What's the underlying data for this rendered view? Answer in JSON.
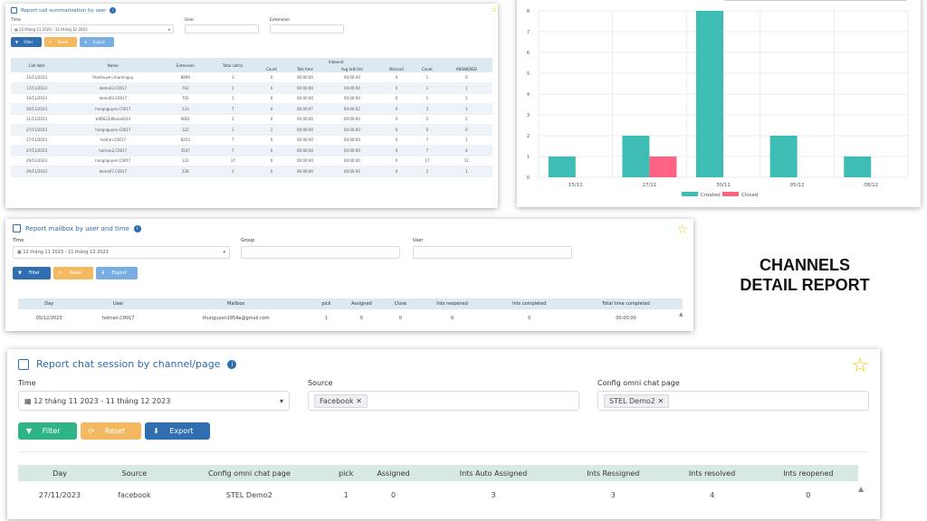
{
  "call_report": {
    "title": "Report call summarization by user",
    "filters": {
      "time_label": "Time",
      "time_value": "12 tháng 11 2023 - 11 tháng 12 2023",
      "user_label": "User",
      "extension_label": "Extension"
    },
    "buttons": {
      "filter": "Filter",
      "reset": "Reset",
      "export": "Export"
    },
    "group_header": "Inbound",
    "columns": [
      "Call date",
      "Name",
      "Extension",
      "Total call(s)",
      "Count",
      "Talk time",
      "Avg talk tim",
      "Misscall",
      "Count",
      "ANSWERED"
    ],
    "rows": [
      [
        "15/11/2023",
        "thanhuyen.chanhnguy",
        "8899",
        "1",
        "0",
        "00:00:00",
        "00:00:00",
        "0",
        "1",
        "0"
      ],
      [
        "17/11/2023",
        "demo03.C0017",
        "702",
        "1",
        "0",
        "00:00:00",
        "00:00:00",
        "0",
        "1",
        "1"
      ],
      [
        "19/11/2023",
        "demo03.C0017",
        "702",
        "1",
        "0",
        "00:00:00",
        "00:00:00",
        "0",
        "1",
        "1"
      ],
      [
        "20/11/2023",
        "hongnguyen.C0017",
        "133",
        "7",
        "4",
        "00:00:07",
        "00:00:02",
        "0",
        "3",
        "3"
      ],
      [
        "21/11/2023",
        "tdf6622d9a2e0034",
        "6001",
        "2",
        "0",
        "00:00:00",
        "00:00:00",
        "0",
        "2",
        "2"
      ],
      [
        "27/11/2023",
        "hongnguyen.C0017",
        "122",
        "1",
        "1",
        "00:00:00",
        "00:00:00",
        "0",
        "0",
        "0"
      ],
      [
        "27/11/2023",
        "hoitran.C0017",
        "8253",
        "7",
        "0",
        "00:00:00",
        "00:00:00",
        "0",
        "7",
        "1"
      ],
      [
        "27/11/2023",
        "hoitran2.C0017",
        "3547",
        "7",
        "0",
        "00:00:00",
        "00:00:00",
        "0",
        "7",
        "4"
      ],
      [
        "29/11/2023",
        "hongnguyen.C0017",
        "122",
        "17",
        "0",
        "00:00:00",
        "00:00:00",
        "0",
        "17",
        "12"
      ],
      [
        "29/11/2023",
        "demo07.C0017",
        "238",
        "2",
        "0",
        "00:00:00",
        "00:00:00",
        "0",
        "2",
        "1"
      ]
    ]
  },
  "chart_data": {
    "type": "bar",
    "categories": [
      "15/11",
      "27/11",
      "30/11",
      "05/12",
      "08/12"
    ],
    "series": [
      {
        "name": "Created",
        "color": "#3dbdb4",
        "values": [
          1,
          2,
          8,
          2,
          1
        ]
      },
      {
        "name": "Closed",
        "color": "#ff6384",
        "values": [
          0,
          1,
          0,
          0,
          0
        ]
      }
    ],
    "ylim": [
      0,
      8
    ],
    "yticks": [
      "0",
      "1",
      "2",
      "3",
      "4",
      "5",
      "6",
      "7",
      "8"
    ],
    "grid": true,
    "legend": "bottom"
  },
  "mailbox_report": {
    "title": "Report mailbox by user and time",
    "filters": {
      "time_label": "Time",
      "time_value": "12 tháng 11 2023 - 11 tháng 12 2023",
      "group_label": "Group",
      "user_label": "User"
    },
    "buttons": {
      "filter": "Filter",
      "reset": "Reset",
      "export": "Export"
    },
    "columns": [
      "Day",
      "User",
      "Mailbox",
      "pick",
      "Assigned",
      "Close",
      "Ints reopened",
      "Ints completed",
      "Total time completed"
    ],
    "rows": [
      [
        "05/12/2023",
        "hoitran.C0017",
        "thunguyen1854a@gmail.com",
        "1",
        "0",
        "0",
        "0",
        "0",
        "00:00:00"
      ]
    ]
  },
  "heading": {
    "line1": "CHANNELS",
    "line2": "DETAIL REPORT"
  },
  "chat_report": {
    "title": "Report chat session by channel/page",
    "filters": {
      "time_label": "Time",
      "time_value": "12 tháng 11 2023 - 11 tháng 12 2023",
      "source_label": "Source",
      "source_tag": "Facebook",
      "config_label": "Config omni chat page",
      "config_tag": "STEL Demo2"
    },
    "buttons": {
      "filter": "Filter",
      "reset": "Reset",
      "export": "Export"
    },
    "columns": [
      "Day",
      "Source",
      "Config omni chat page",
      "pick",
      "Assigned",
      "Ints Auto Assigned",
      "Ints Ressigned",
      "Ints resolved",
      "Ints reopened"
    ],
    "rows": [
      [
        "27/11/2023",
        "facebook",
        "STEL Demo2",
        "1",
        "0",
        "3",
        "3",
        "4",
        "0"
      ]
    ]
  }
}
